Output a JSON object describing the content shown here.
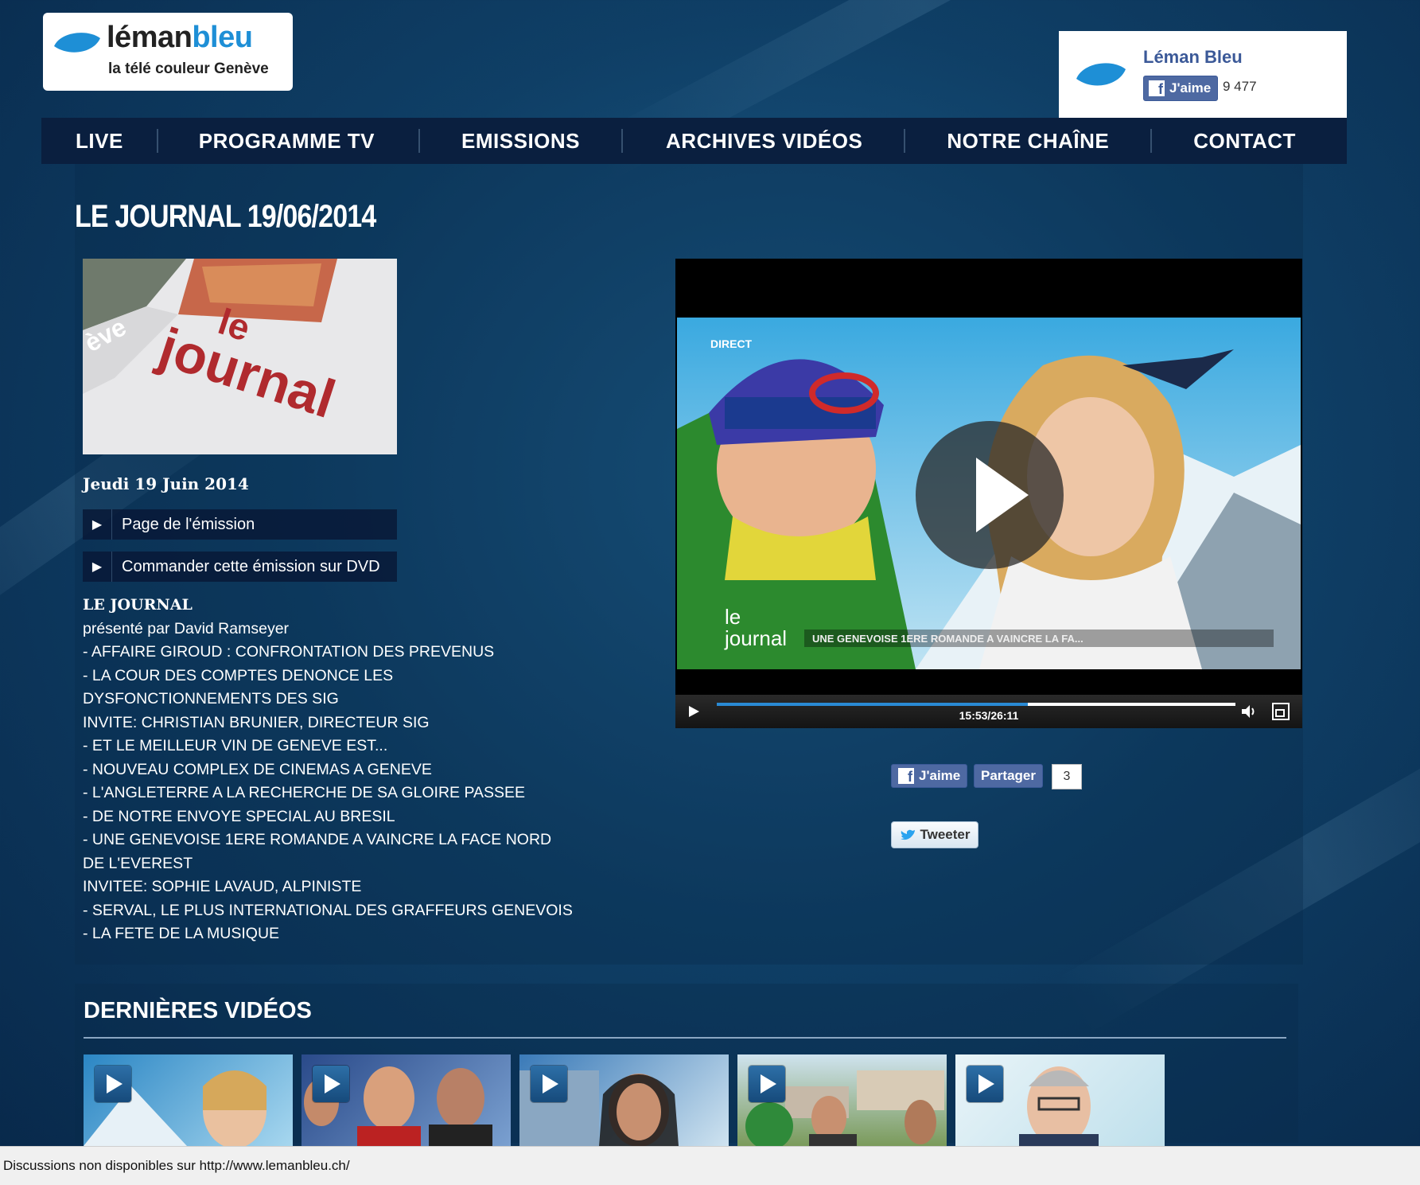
{
  "logo": {
    "brand_part1": "léman",
    "brand_part2": "bleu",
    "tagline": "la télé couleur Genève"
  },
  "facebook_widget": {
    "page_name": "Léman Bleu",
    "like_label": "J'aime",
    "like_count": "9 477"
  },
  "nav": {
    "items": [
      "LIVE",
      "PROGRAMME TV",
      "EMISSIONS",
      "ARCHIVES VIDÉOS",
      "NOTRE CHAÎNE",
      "CONTACT"
    ]
  },
  "page_title": "LE JOURNAL 19/06/2014",
  "episode": {
    "thumbnail_text": {
      "line1": "le",
      "line2": "journal",
      "side": "ève"
    },
    "date": "Jeudi 19 Juin 2014",
    "links": [
      "Page de l'émission",
      "Commander cette émission sur DVD"
    ],
    "description_title": "LE JOURNAL",
    "description_lines": [
      "présenté par David Ramseyer",
      "- AFFAIRE GIROUD : CONFRONTATION DES PREVENUS",
      "- LA COUR DES COMPTES DENONCE LES DYSFONCTIONNEMENTS DES SIG",
      "INVITE: CHRISTIAN BRUNIER, DIRECTEUR SIG",
      "- ET LE MEILLEUR VIN DE GENEVE EST...",
      "- NOUVEAU COMPLEX DE CINEMAS A GENEVE",
      "- L'ANGLETERRE A LA RECHERCHE DE SA GLOIRE PASSEE",
      "- DE NOTRE ENVOYE SPECIAL AU BRESIL",
      "- UNE GENEVOISE 1ERE ROMANDE A VAINCRE LA FACE NORD DE L'EVEREST",
      "INVITEE: SOPHIE LAVAUD, ALPINISTE",
      "- SERVAL, LE PLUS INTERNATIONAL DES GRAFFEURS GENEVOIS",
      "- LA FETE DE LA MUSIQUE"
    ]
  },
  "video_player": {
    "overlay_direct": "DIRECT",
    "overlay_logo_line1": "le",
    "overlay_logo_line2": "journal",
    "ticker": "UNE GENEVOISE 1ERE ROMANDE A VAINCRE LA FA...",
    "time": "15:53/26:11",
    "progress": 0.6
  },
  "share": {
    "like_label": "J'aime",
    "share_label": "Partager",
    "share_count": "3",
    "tweet_label": "Tweeter"
  },
  "latest_videos": {
    "title": "DERNIÈRES VIDÉOS",
    "count": 5
  },
  "status_bar": {
    "text": "Discussions non disponibles sur http://www.lemanbleu.ch/"
  },
  "colors": {
    "accent": "#1e8fd6",
    "nav_bg": "#0a1f3f",
    "facebook": "#3b5998",
    "page_bg": "#0f3f66"
  }
}
